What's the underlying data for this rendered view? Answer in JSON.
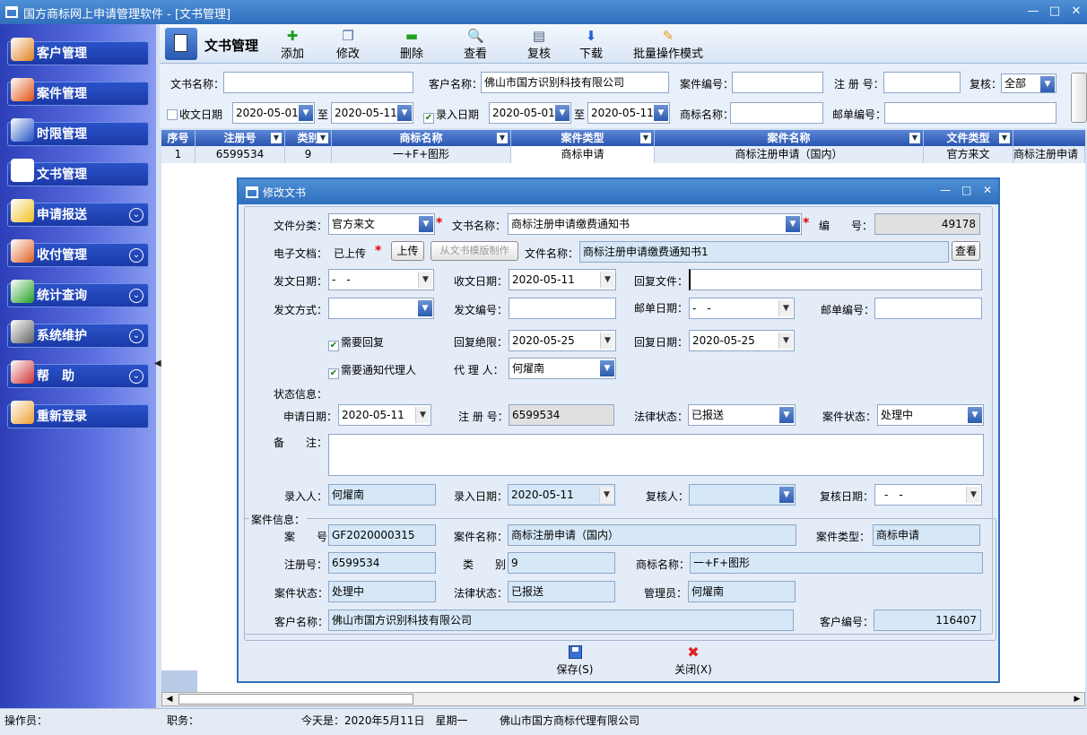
{
  "app": {
    "title": "国方商标网上申请管理软件 - [文书管理]",
    "min": "—",
    "max": "□",
    "close": "✕"
  },
  "sidebar": {
    "items": [
      {
        "label": "客户管理",
        "icon": "users-icon",
        "color": "#e08020"
      },
      {
        "label": "案件管理",
        "icon": "case-box-icon",
        "color": "#e05010"
      },
      {
        "label": "时限管理",
        "icon": "clock-icon",
        "color": "#2050c0"
      },
      {
        "label": "文书管理",
        "icon": "document-icon",
        "color": "#ffffff"
      },
      {
        "label": "申请报送",
        "icon": "pencil-icon",
        "color": "#f0c020",
        "chev": "⌄"
      },
      {
        "label": "收付管理",
        "icon": "payment-icon",
        "color": "#e06020",
        "chev": "⌄"
      },
      {
        "label": "统计查询",
        "icon": "chart-icon",
        "color": "#20a020",
        "chev": "⌄"
      },
      {
        "label": "系统维护",
        "icon": "tools-icon",
        "color": "#606060",
        "chev": "⌄"
      },
      {
        "label": "帮　助",
        "icon": "help-icon",
        "color": "#d03030",
        "chev": "⌄"
      },
      {
        "label": "重新登录",
        "icon": "relogin-icon",
        "color": "#f0a030"
      }
    ]
  },
  "toolbar": {
    "title": "文书管理",
    "buttons": [
      {
        "label": "添加",
        "icon": "add-icon",
        "glyph": "✚",
        "color": "#20a020"
      },
      {
        "label": "修改",
        "icon": "edit-icon",
        "glyph": "❐",
        "color": "#5070a0"
      },
      {
        "label": "删除",
        "icon": "delete-icon",
        "glyph": "▬",
        "color": "#20a020"
      },
      {
        "label": "查看",
        "icon": "view-icon",
        "glyph": "🔍",
        "color": "#3060c0"
      },
      {
        "label": "复核",
        "icon": "review-icon",
        "glyph": "▤",
        "color": "#506080"
      },
      {
        "label": "下载",
        "icon": "download-icon",
        "glyph": "⬇",
        "color": "#2060d0"
      },
      {
        "label": "批量操作模式",
        "icon": "batch-icon",
        "glyph": "✎",
        "color": "#e0a020"
      }
    ]
  },
  "filter": {
    "doc_name_label": "文书名称：",
    "doc_name": "",
    "client_label": "客户名称：",
    "client": "佛山市国方识别科技有限公司",
    "case_no_label": "案件编号：",
    "case_no": "",
    "reg_no_label": "注 册 号：",
    "reg_no": "",
    "review_label": "复核：",
    "review": "全部",
    "recv_date_label": "收文日期",
    "recv_from": "2020-05-01",
    "recv_to": "2020-05-11",
    "to": "至",
    "entry_date_label": "录入日期",
    "entry_from": "2020-05-01",
    "entry_to": "2020-05-11",
    "tm_name_label": "商标名称：",
    "tm_name": "",
    "mail_no_label": "邮单编号：",
    "mail_no": ""
  },
  "grid": {
    "headers": [
      "序号",
      "注册号",
      "类别",
      "商标名称",
      "案件类型",
      "案件名称",
      "文件类型"
    ],
    "rows": [
      [
        "1",
        "6599534",
        "9",
        "一+F+图形",
        "商标申请",
        "商标注册申请（国内）",
        "官方来文",
        "商标注册申请"
      ]
    ]
  },
  "status": {
    "operator": "操作员：",
    "duty": "职务：",
    "today": "今天是：2020年5月11日　星期一",
    "company": "佛山市国方商标代理有限公司"
  },
  "dialog": {
    "title": "修改文书",
    "min": "—",
    "max": "□",
    "close": "✕",
    "file_cat_label": "文件分类：",
    "file_cat": "官方来文",
    "doc_name_label": "文书名称：",
    "doc_name": "商标注册申请缴费通知书",
    "no_label": "编　　号：",
    "no": "49178",
    "edoc_label": "电子文档：",
    "edoc": "已上传",
    "upload": "上传",
    "from_tpl": "从文书模版制作",
    "file_name_label": "文件名称：",
    "file_name": "商标注册申请缴费通知书1",
    "view": "查看",
    "send_date_label": "发文日期：",
    "send_date": "-　-",
    "recv_date_label": "收文日期：",
    "recv_date": "2020-05-11",
    "reply_file_label": "回复文件：",
    "reply_file": "",
    "send_way_label": "发文方式：",
    "send_way": "",
    "send_no_label": "发文编号：",
    "send_no": "",
    "mail_date_label": "邮单日期：",
    "mail_date": "-　-",
    "mail_no_label": "邮单编号：",
    "mail_no": "",
    "need_reply": "需要回复",
    "need_notify": "需要通知代理人",
    "reply_deadline_label": "回复绝限：",
    "reply_deadline": "2020-05-25",
    "reply_date_label": "回复日期：",
    "reply_date": "2020-05-25",
    "agent_label": "代 理 人：",
    "agent": "何燿南",
    "status_info": "状态信息：",
    "apply_date_label": "申请日期：",
    "apply_date": "2020-05-11",
    "reg_no_label": "注 册 号：",
    "reg_no": "6599534",
    "legal_label": "法律状态：",
    "legal": "已报送",
    "case_state_label": "案件状态：",
    "case_state": "处理中",
    "remark_label": "备　　注：",
    "remark": "",
    "entry_person_label": "录入人：",
    "entry_person": "何燿南",
    "entry_date_label": "录入日期：",
    "entry_date": "2020-05-11",
    "reviewer_label": "复核人：",
    "reviewer": "",
    "review_date_label": "复核日期：",
    "review_date": "-　-",
    "case_info": "案件信息：",
    "case_no_label": "案　　号：",
    "case_no": "GF2020000315",
    "case_name_label": "案件名称：",
    "case_name": "商标注册申请（国内）",
    "case_type_label": "案件类型：",
    "case_type": "商标申请",
    "reg2_label": "注册号：",
    "reg2": "6599534",
    "class_label": "类　　别：",
    "class": "9",
    "tm_label": "商标名称：",
    "tm": "一+F+图形",
    "cstate_label": "案件状态：",
    "cstate": "处理中",
    "lstate_label": "法律状态：",
    "lstate": "已报送",
    "manager_label": "管理员：",
    "manager": "何燿南",
    "client_label": "客户名称：",
    "client": "佛山市国方识别科技有限公司",
    "client_no_label": "客户编号：",
    "client_no": "116407",
    "save": "保存(S)",
    "close_btn": "关闭(X)"
  }
}
